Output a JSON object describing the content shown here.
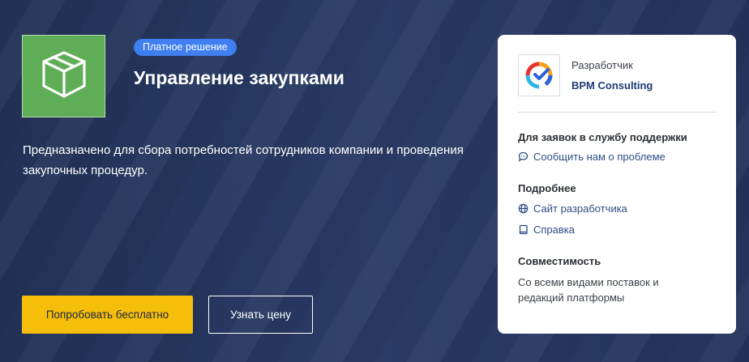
{
  "product": {
    "badge": "Платное решение",
    "title": "Управление закупками",
    "description": "Предназначено для сбора потребностей сотрудников компании и проведения закупочных процедур.",
    "icon": "box-icon"
  },
  "actions": {
    "try_free": "Попробовать бесплатно",
    "get_price": "Узнать цену"
  },
  "sidebar": {
    "developer_label": "Разработчик",
    "developer_name": "BPM Consulting",
    "support_title": "Для заявок в службу поддержки",
    "support_link": "Сообщить нам о проблеме",
    "more_title": "Подробнее",
    "dev_site_link": "Сайт разработчика",
    "help_link": "Справка",
    "compat_title": "Совместимость",
    "compat_text": "Со всеми видами поставок и редакций платформы"
  },
  "colors": {
    "background": "#26365e",
    "tile": "#5fae57",
    "badge": "#3f7ff0",
    "primary_button": "#f5be0b",
    "link": "#2d4d86"
  }
}
